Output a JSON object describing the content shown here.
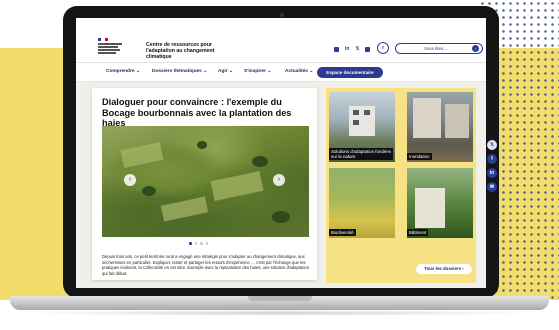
{
  "header": {
    "site_title": "Centre de ressources pour l'adaptation au changement climatique",
    "social": [
      "in",
      "𝕏"
    ],
    "search_placeholder": "Vous êtes...",
    "search_icon": "search-icon"
  },
  "nav": {
    "items": [
      {
        "label": "Comprendre ⌄"
      },
      {
        "label": "Dossiers thématiques ⌄"
      },
      {
        "label": "Agir ⌄"
      },
      {
        "label": "S'inspirer ⌄"
      },
      {
        "label": "Actualités ⌄"
      }
    ],
    "cta_label": "Espace documentaire"
  },
  "article": {
    "title": "Dialoguer pour convaincre : l'exemple du Bocage bourbonnais avec la plantation des haies",
    "prev_icon": "‹",
    "next_icon": "›",
    "text": "Depuis trois ans, ce petit territoire rural a engagé une stratégie pour s'adapter au changement climatique, aux sécheresses en particulier. Expliquer, tester et partager les retours d'expérience … c'est par l'échange que les pratiques évoluent, la Collectivité en est sûre. Exemple avec la replantation des haies, une solution d'adaptation qui fait débat."
  },
  "tiles": {
    "items": [
      {
        "label": "Solutions d'adaptation fondées sur la nature"
      },
      {
        "label": "Inondation"
      },
      {
        "label": "Biodiversité"
      },
      {
        "label": "Bâtiment"
      }
    ],
    "button_label": "Tous les dossiers ›"
  },
  "share": [
    "𝕏",
    "f",
    "in",
    "✉"
  ],
  "colors": {
    "accent": "#2a3c8f",
    "background": "#f2dc6a",
    "panel": "#f6e285"
  }
}
